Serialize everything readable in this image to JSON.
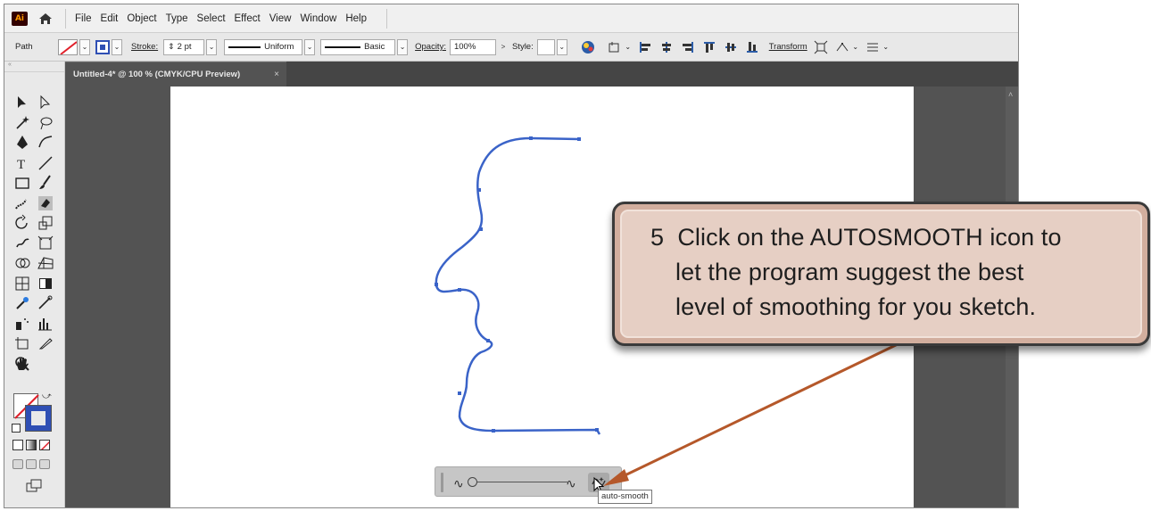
{
  "menubar": {
    "logo": "Ai",
    "items": [
      "File",
      "Edit",
      "Object",
      "Type",
      "Select",
      "Effect",
      "View",
      "Window",
      "Help"
    ]
  },
  "control_bar": {
    "selection": "Path",
    "stroke_label": "Stroke:",
    "stroke_value": "2 pt",
    "profile_uniform": "Uniform",
    "brush_basic": "Basic",
    "opacity_label": "Opacity:",
    "opacity_value": "100%",
    "style_label": "Style:",
    "transform_label": "Transform"
  },
  "document_tab": {
    "title": "Untitled-4* @ 100 % (CMYK/CPU Preview)",
    "close": "×"
  },
  "tool_icons": [
    "selection-tool-icon",
    "direct-selection-tool-icon",
    "magic-wand-icon",
    "lasso-icon",
    "pen-tool-icon",
    "curvature-tool-icon",
    "type-tool-icon",
    "line-tool-icon",
    "rectangle-tool-icon",
    "paintbrush-icon",
    "shaper-tool-icon",
    "eraser-icon",
    "rotate-tool-icon",
    "scale-tool-icon",
    "warp-tool-icon",
    "free-transform-icon",
    "shape-builder-icon",
    "perspective-grid-icon",
    "mesh-tool-icon",
    "gradient-tool-icon",
    "eyedropper-icon",
    "blend-tool-icon",
    "symbol-sprayer-icon",
    "column-graph-icon",
    "artboard-tool-icon",
    "slice-tool-icon",
    "hand-tool-icon",
    "zoom-tool-icon"
  ],
  "context_bar": {
    "smoothness_fraction": 0.0,
    "tooltip": "auto-smooth"
  },
  "callout": {
    "number": "5",
    "lines": [
      "Click on the AUTOSMOOTH icon to",
      "let the program suggest the best",
      "level of smoothing for you sketch."
    ]
  },
  "colors": {
    "path_stroke": "#3a63c8",
    "callout_fill": "#e6cfc4",
    "arrow": "#b5582a"
  }
}
